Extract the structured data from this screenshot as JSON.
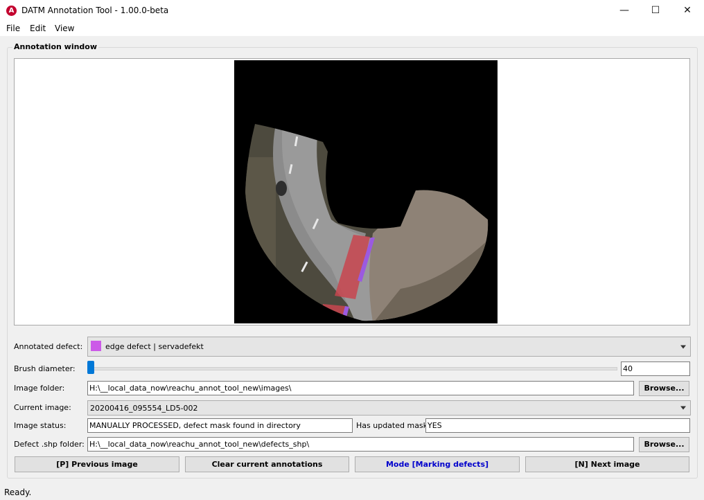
{
  "window": {
    "icon_letter": "A",
    "title": "DATM Annotation Tool - 1.00.0-beta",
    "minimize": "—",
    "maximize": "☐",
    "close": "✕"
  },
  "menu": [
    "File",
    "Edit",
    "View"
  ],
  "annotation_group_title": "Annotation window",
  "controls": {
    "annotated_defect_label": "Annotated defect:",
    "annotated_defect_value": "edge defect | servadefekt",
    "annotated_defect_color": "#cc5ae8",
    "brush_label": "Brush diameter:",
    "brush_value": "40",
    "image_folder_label": "Image folder:",
    "image_folder_value": "H:\\__local_data_now\\reachu_annot_tool_new\\images\\",
    "browse_label": "Browse...",
    "current_image_label": "Current image:",
    "current_image_value": "20200416_095554_LD5-002",
    "image_status_label": "Image status:",
    "image_status_value": "MANUALLY PROCESSED, defect mask found in directory",
    "updated_mask_label": "Has updated mask?",
    "updated_mask_value": "YES",
    "shp_folder_label": "Defect .shp folder:",
    "shp_folder_value": "H:\\__local_data_now\\reachu_annot_tool_new\\defects_shp\\"
  },
  "buttons": {
    "prev": "[P] Previous image",
    "clear": "Clear current annotations",
    "mode": "Mode [Marking defects]",
    "next": "[N] Next image"
  },
  "colors": {
    "mode_text": "#0000cc",
    "accent": "#0078d7"
  },
  "status": "Ready."
}
